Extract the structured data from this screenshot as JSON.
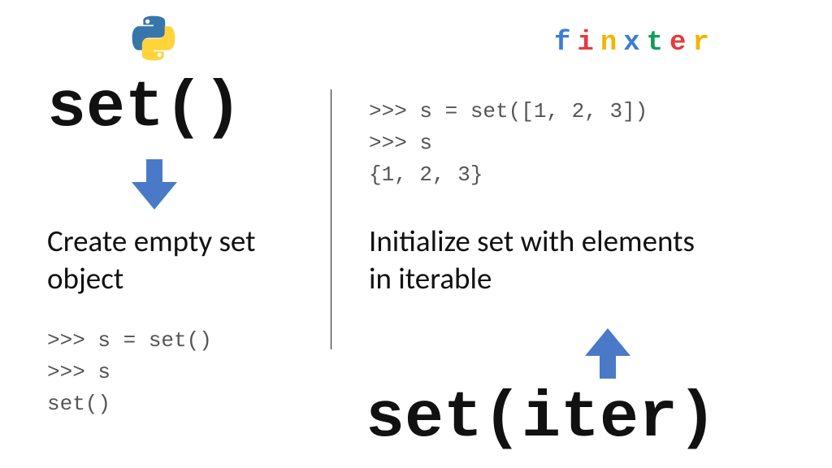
{
  "brand": {
    "letters": [
      "f",
      "i",
      "n",
      "x",
      "t",
      "e",
      "r"
    ]
  },
  "left": {
    "heading": "set()",
    "description": "Create empty set object",
    "code": ">>> s = set()\n>>> s\nset()"
  },
  "right": {
    "heading": "set(iter)",
    "description": "Initialize set with elements in iterable",
    "code": ">>> s = set([1, 2, 3])\n>>> s\n{1, 2, 3}"
  }
}
